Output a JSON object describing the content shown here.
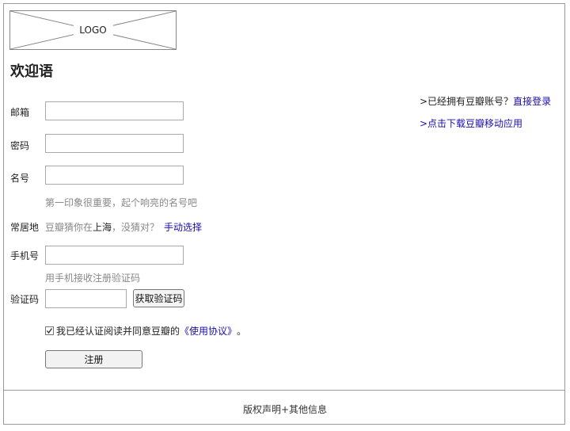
{
  "logo": {
    "text": "LOGO"
  },
  "welcome": "欢迎语",
  "form": {
    "email": {
      "label": "邮箱",
      "value": ""
    },
    "password": {
      "label": "密码",
      "value": ""
    },
    "nickname": {
      "label": "名号",
      "value": "",
      "hint": "第一印象很重要，起个响亮的名号吧"
    },
    "residence": {
      "label": "常居地",
      "guess_prefix": "豆瓣猜你在",
      "city": "上海",
      "guess_suffix": "，没猜对？",
      "manual_link": "手动选择"
    },
    "phone": {
      "label": "手机号",
      "value": "",
      "hint": "用手机接收注册验证码"
    },
    "code": {
      "label": "验证码",
      "value": "",
      "button": "获取验证码"
    },
    "agreement": {
      "checked": true,
      "text": "我已经认证阅读并同意豆瓣的",
      "link": "《使用协议》",
      "end": "。"
    },
    "register_button": "注册"
  },
  "side": {
    "login_prefix": ">已经拥有豆瓣账号？",
    "login_link": "直接登录",
    "app_link": ">点击下载豆瓣移动应用"
  },
  "footer": {
    "text": "版权声明+其他信息"
  },
  "colors": {
    "link": "#1a0dab",
    "hint": "#888888",
    "border": "#999999"
  }
}
